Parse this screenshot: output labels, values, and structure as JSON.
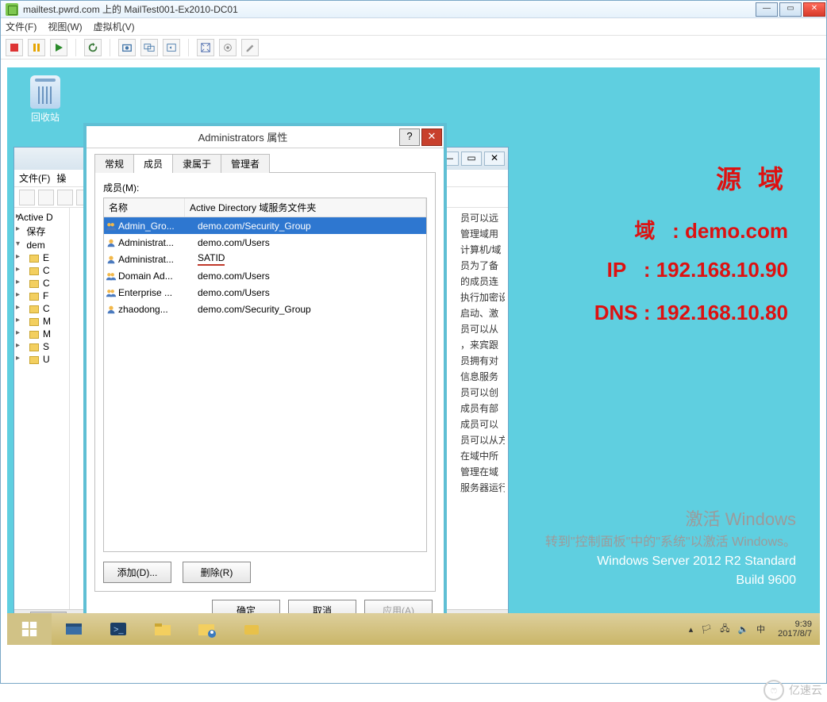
{
  "host": {
    "title": "mailtest.pwrd.com 上的 MailTest001-Ex2010-DC01",
    "menu": [
      "文件(F)",
      "视图(W)",
      "虚拟机(V)"
    ],
    "win_btns": {
      "min": "—",
      "max": "▭",
      "close": "✕"
    }
  },
  "guest_desktop": {
    "recycle_label": "回收站",
    "big_red": "源 域",
    "red_domain_label": "域",
    "red_domain_value": ": demo.com",
    "red_ip_label": "IP",
    "red_ip_value": ": 192.168.10.90",
    "red_dns_label": "DNS",
    "red_dns_value": ": 192.168.10.80",
    "activation_title": "激活 Windows",
    "activation_sub": "转到\"控制面板\"中的\"系统\"以激活 Windows。",
    "os_line1": "Windows Server 2012 R2 Standard",
    "os_line2": "Build 9600"
  },
  "aduc": {
    "menu_file": "文件(F)",
    "menu_more": "操",
    "tree_root": "Active D",
    "tree_saved": "保存",
    "tree_domain": "dem",
    "tree_items": [
      "E",
      "C",
      "C",
      "F",
      "C",
      "M",
      "M",
      "S",
      "U"
    ],
    "hidden_lines": [
      "员可以远",
      "管理域用",
      "计算机/域",
      "员为了备",
      "的成员连",
      "执行加密设",
      "启动、激",
      "员可以从",
      "，来宾跟",
      "员拥有对",
      "信息服务",
      "员可以创",
      "成员有部",
      "成员可以",
      "员可以从方",
      "在域中所",
      "管理在域",
      "服务器运行"
    ]
  },
  "dialog": {
    "title": "Administrators 属性",
    "help": "?",
    "close": "✕",
    "tabs": [
      "常规",
      "成员",
      "隶属于",
      "管理者"
    ],
    "active_tab": 1,
    "members_label": "成员(M):",
    "col_name": "名称",
    "col_folder": "Active Directory 域服务文件夹",
    "rows": [
      {
        "icon": "group",
        "name": "Admin_Gro...",
        "folder": "demo.com/Security_Group",
        "selected": true
      },
      {
        "icon": "user",
        "name": "Administrat...",
        "folder": "demo.com/Users"
      },
      {
        "icon": "user",
        "name": "Administrat...",
        "folder": "SATID",
        "underline": true
      },
      {
        "icon": "group",
        "name": "Domain Ad...",
        "folder": "demo.com/Users"
      },
      {
        "icon": "group",
        "name": "Enterprise ...",
        "folder": "demo.com/Users"
      },
      {
        "icon": "user",
        "name": "zhaodong...",
        "folder": "demo.com/Security_Group"
      }
    ],
    "add_btn": "添加(D)...",
    "remove_btn": "删除(R)",
    "ok": "确定",
    "cancel": "取消",
    "apply": "应用(A)"
  },
  "taskbar": {
    "time": "9:39",
    "date": "2017/8/7",
    "tray_arrow": "▴"
  },
  "watermark": "亿速云"
}
